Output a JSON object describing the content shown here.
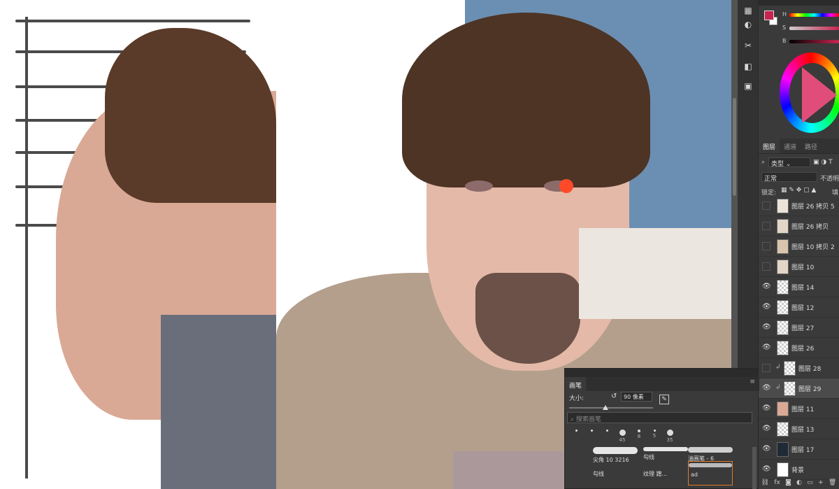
{
  "brush_panel": {
    "title": "画笔",
    "size_label": "大小:",
    "size_value": "90 像素",
    "search_placeholder": "搜索画笔",
    "preset_sizes": [
      "45",
      "8",
      "5",
      "35"
    ],
    "brushes": [
      {
        "label": "尖角 10 3216"
      },
      {
        "label": "勾线"
      },
      {
        "label": "油画笔 - 6"
      },
      {
        "label": "勾线"
      },
      {
        "label": "纹理 蹭..."
      },
      {
        "label": "ad"
      }
    ]
  },
  "right_panel": {
    "color": {
      "foreground": "#c8244f",
      "slider_labels": [
        "H",
        "S",
        "B"
      ]
    },
    "tabs": [
      "图层",
      "通道",
      "路径"
    ],
    "filter_label": "类型",
    "blend_mode": "正常",
    "opacity_label": "不透明",
    "lock_label": "锁定:",
    "fill_label": "填",
    "layers": [
      {
        "name": "图层 26 拷贝 5",
        "visible": false
      },
      {
        "name": "图层 26 拷贝",
        "visible": false
      },
      {
        "name": "图层 10 拷贝 2",
        "visible": false
      },
      {
        "name": "图层 10",
        "visible": false
      },
      {
        "name": "图层 14",
        "visible": true
      },
      {
        "name": "图层 12",
        "visible": true
      },
      {
        "name": "图层 27",
        "visible": true
      },
      {
        "name": "图层 26",
        "visible": true
      },
      {
        "name": "图层 28",
        "visible": false,
        "clipped": true
      },
      {
        "name": "图层 29",
        "visible": true,
        "clipped": true,
        "selected": true
      },
      {
        "name": "图层 11",
        "visible": true
      },
      {
        "name": "图层 13",
        "visible": true
      },
      {
        "name": "图层 17",
        "visible": true
      },
      {
        "name": "背景",
        "visible": true
      }
    ],
    "footer_icons": [
      "link-icon",
      "fx-icon",
      "mask-icon",
      "adjustment-icon",
      "folder-icon",
      "new-layer-icon",
      "trash-icon"
    ]
  }
}
